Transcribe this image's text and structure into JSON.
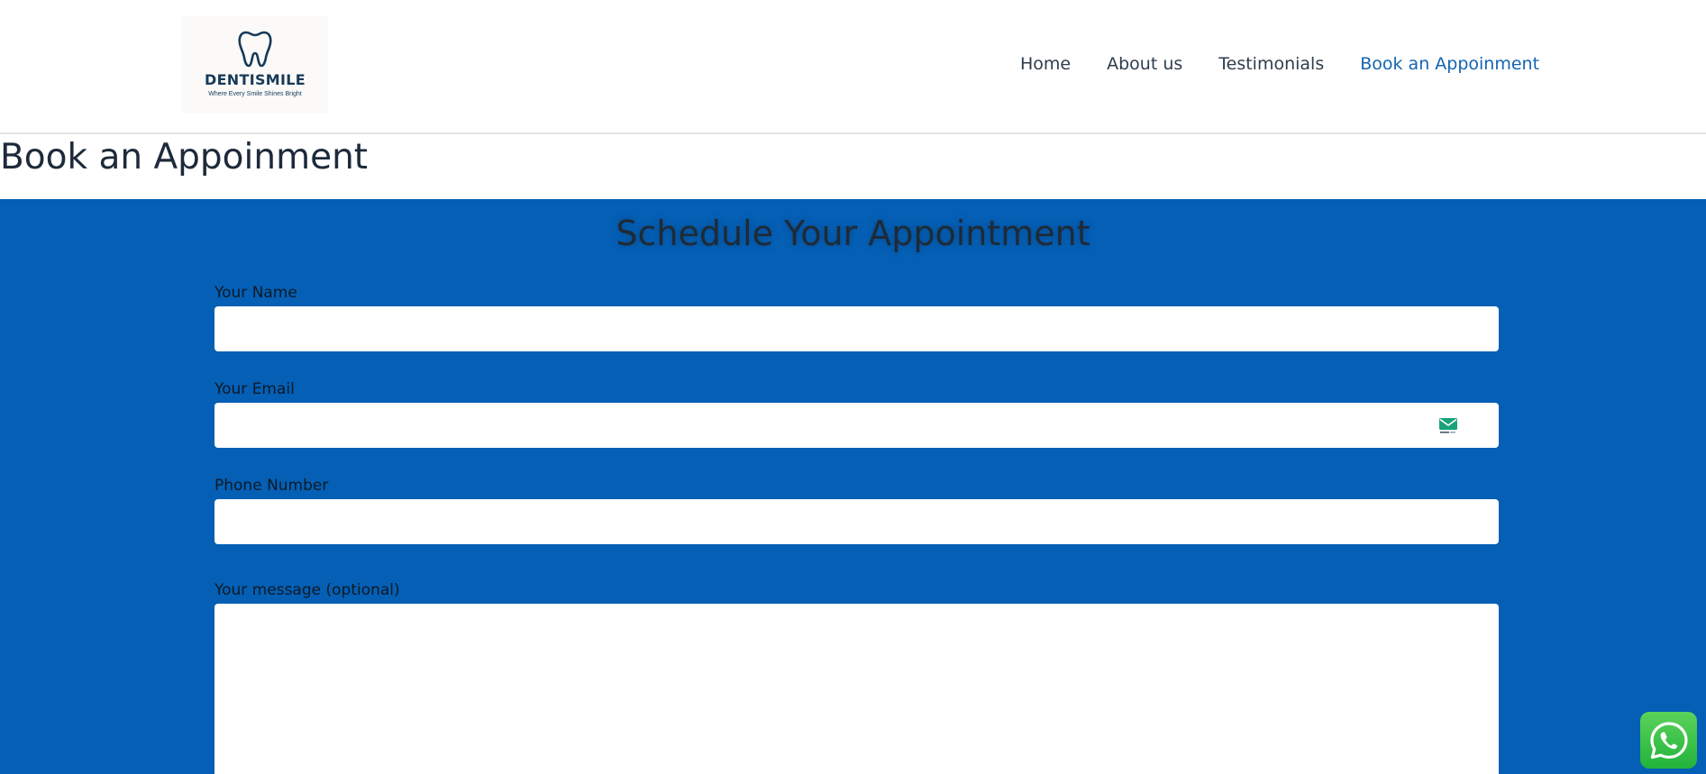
{
  "header": {
    "logo": {
      "name": "DENTISMILE",
      "tagline": "Where Every Smile Shines Bright",
      "icon": "tooth-icon"
    },
    "nav": [
      {
        "label": "Home",
        "active": false
      },
      {
        "label": "About us",
        "active": false
      },
      {
        "label": "Testimonials",
        "active": false
      },
      {
        "label": "Book an Appoinment",
        "active": true
      }
    ]
  },
  "page": {
    "title": "Book an Appoinment"
  },
  "form": {
    "heading": "Schedule Your Appointment",
    "fields": {
      "name": {
        "label": "Your Name",
        "value": ""
      },
      "email": {
        "label": "Your Email",
        "value": "",
        "extension_icon": "email-extension-icon"
      },
      "phone": {
        "label": "Phone Number",
        "value": ""
      },
      "message": {
        "label": "Your message (optional)",
        "value": ""
      }
    }
  },
  "floating": {
    "whatsapp_icon": "whatsapp-icon"
  },
  "colors": {
    "section_bg": "#045fb5",
    "nav_active": "#1464b3",
    "nav_text": "#2f3d4c",
    "logo_text": "#173a58",
    "whatsapp": "#25d366"
  }
}
